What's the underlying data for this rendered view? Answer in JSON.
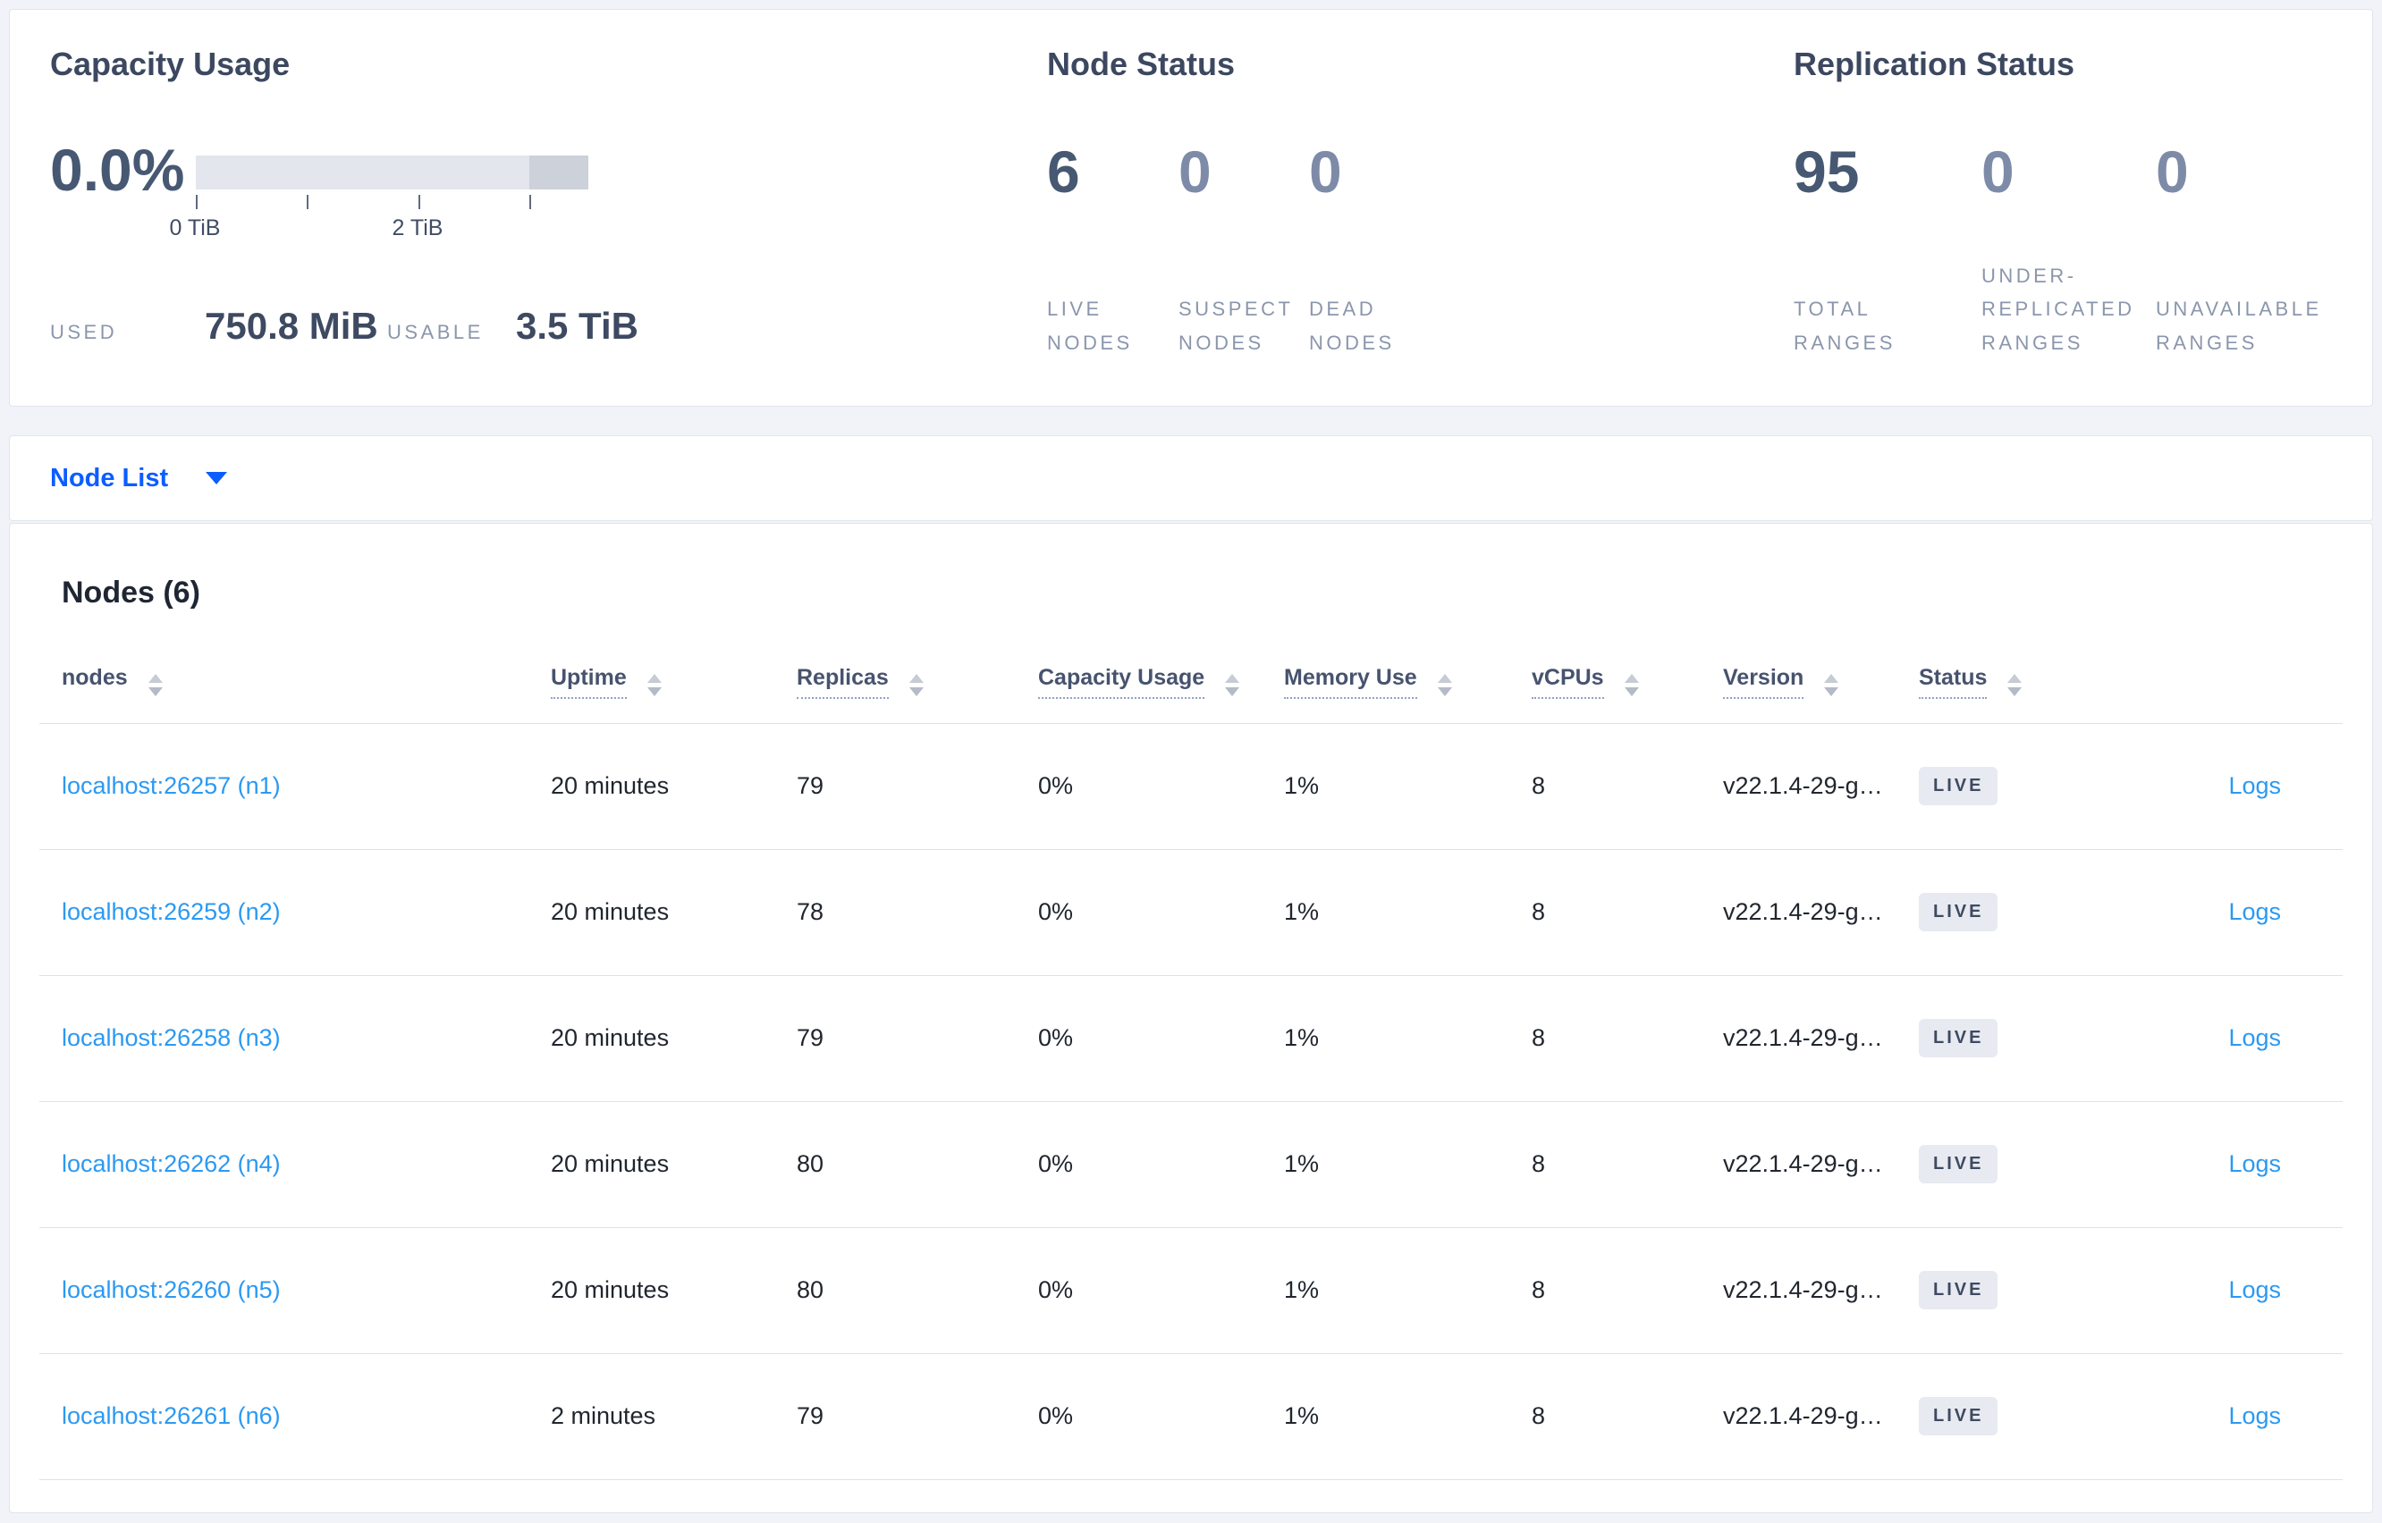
{
  "overview": {
    "capacity": {
      "title": "Capacity Usage",
      "percent": "0.0%",
      "tick_labels": [
        "0 TiB",
        "2 TiB"
      ],
      "used_label": "USED",
      "used_value": "750.8 MiB",
      "usable_label": "USABLE",
      "usable_value": "3.5 TiB"
    },
    "node_status": {
      "title": "Node Status",
      "stats": [
        {
          "value": "6",
          "label": "LIVE NODES"
        },
        {
          "value": "0",
          "label": "SUSPECT NODES"
        },
        {
          "value": "0",
          "label": "DEAD NODES"
        }
      ]
    },
    "replication_status": {
      "title": "Replication Status",
      "stats": [
        {
          "value": "95",
          "label": "TOTAL RANGES"
        },
        {
          "value": "0",
          "label": "UNDER-REPLICATED RANGES"
        },
        {
          "value": "0",
          "label": "UNAVAILABLE RANGES"
        }
      ]
    }
  },
  "node_list": {
    "label": "Node List"
  },
  "nodes_table": {
    "title": "Nodes (6)",
    "columns": [
      {
        "label": "nodes"
      },
      {
        "label": "Uptime"
      },
      {
        "label": "Replicas"
      },
      {
        "label": "Capacity Usage"
      },
      {
        "label": "Memory Use"
      },
      {
        "label": "vCPUs"
      },
      {
        "label": "Version"
      },
      {
        "label": "Status"
      }
    ],
    "rows": [
      {
        "node": "localhost:26257 (n1)",
        "uptime": "20 minutes",
        "replicas": "79",
        "capacity_usage": "0%",
        "memory_use": "1%",
        "vcpus": "8",
        "version": "v22.1.4-29-g…",
        "status": "LIVE",
        "logs_label": "Logs"
      },
      {
        "node": "localhost:26259 (n2)",
        "uptime": "20 minutes",
        "replicas": "78",
        "capacity_usage": "0%",
        "memory_use": "1%",
        "vcpus": "8",
        "version": "v22.1.4-29-g…",
        "status": "LIVE",
        "logs_label": "Logs"
      },
      {
        "node": "localhost:26258 (n3)",
        "uptime": "20 minutes",
        "replicas": "79",
        "capacity_usage": "0%",
        "memory_use": "1%",
        "vcpus": "8",
        "version": "v22.1.4-29-g…",
        "status": "LIVE",
        "logs_label": "Logs"
      },
      {
        "node": "localhost:26262 (n4)",
        "uptime": "20 minutes",
        "replicas": "80",
        "capacity_usage": "0%",
        "memory_use": "1%",
        "vcpus": "8",
        "version": "v22.1.4-29-g…",
        "status": "LIVE",
        "logs_label": "Logs"
      },
      {
        "node": "localhost:26260 (n5)",
        "uptime": "20 minutes",
        "replicas": "80",
        "capacity_usage": "0%",
        "memory_use": "1%",
        "vcpus": "8",
        "version": "v22.1.4-29-g…",
        "status": "LIVE",
        "logs_label": "Logs"
      },
      {
        "node": "localhost:26261 (n6)",
        "uptime": "2 minutes",
        "replicas": "79",
        "capacity_usage": "0%",
        "memory_use": "1%",
        "vcpus": "8",
        "version": "v22.1.4-29-g…",
        "status": "LIVE",
        "logs_label": "Logs"
      }
    ]
  },
  "colors": {
    "primary_blue": "#0b5dff",
    "link_blue": "#2b99f2",
    "dark_slate": "#475872",
    "muted_label": "#8b96ac",
    "badge_bg": "#e7eaf0",
    "bar_light": "#e3e6ec",
    "bar_dark": "#ccd1da",
    "page_bg": "#f1f3f8"
  }
}
